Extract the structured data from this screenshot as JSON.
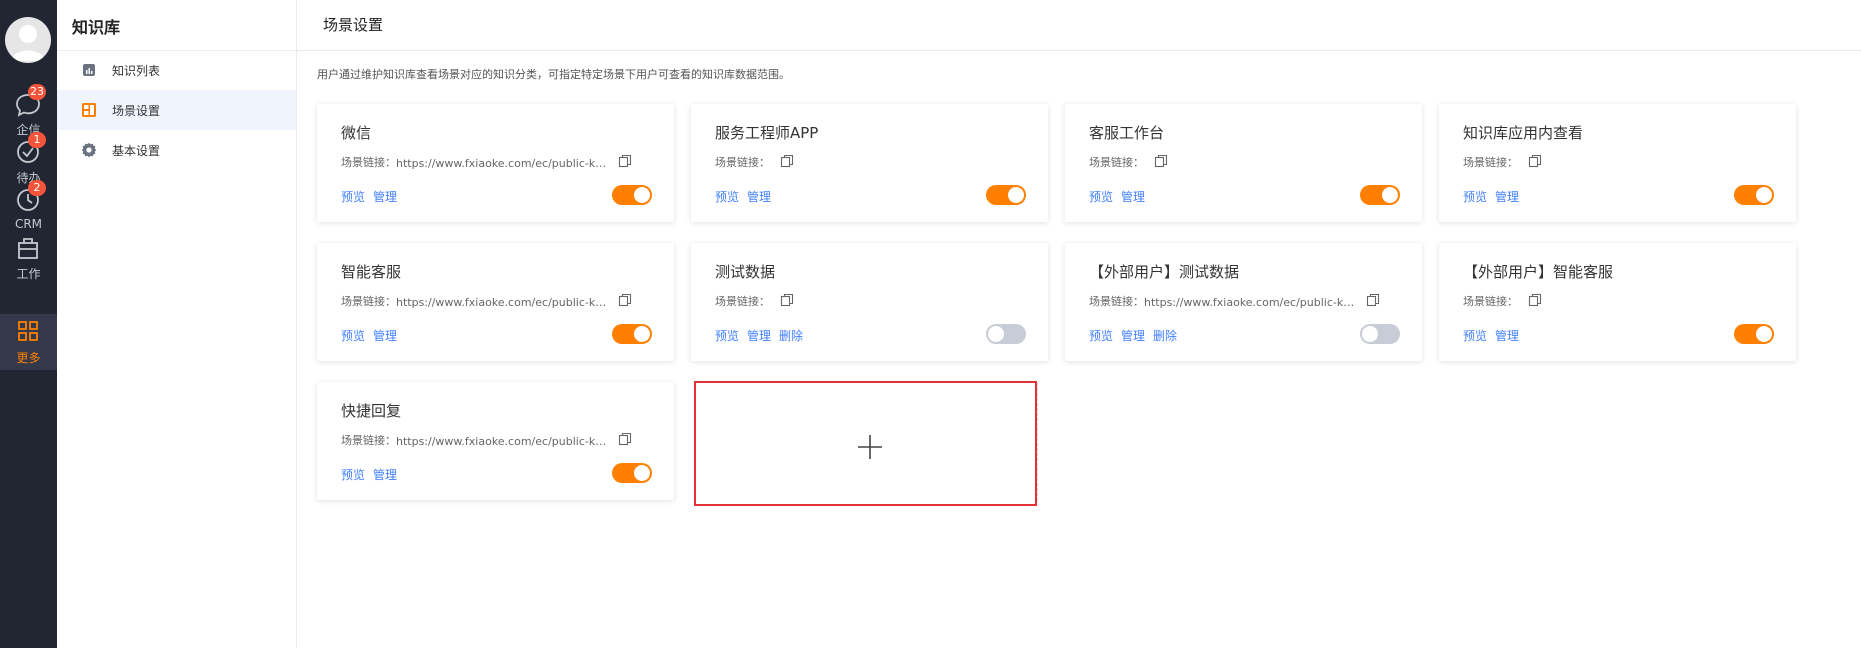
{
  "rail": {
    "items": [
      {
        "label": "企信",
        "badge": "23",
        "icon": "chat-bubble-icon"
      },
      {
        "label": "待办",
        "badge": "1",
        "icon": "check-circle-icon"
      },
      {
        "label": "CRM",
        "badge": "2",
        "icon": "clock-icon"
      },
      {
        "label": "工作",
        "badge": "",
        "icon": "briefcase-icon"
      },
      {
        "label": "更多",
        "badge": "",
        "icon": "grid-icon"
      }
    ]
  },
  "sidebar": {
    "title": "知识库",
    "items": [
      {
        "label": "知识列表",
        "icon": "bar-chart-icon"
      },
      {
        "label": "场景设置",
        "icon": "layout-icon"
      },
      {
        "label": "基本设置",
        "icon": "gear-icon"
      }
    ]
  },
  "main": {
    "title": "场景设置",
    "description": "用户通过维护知识库查看场景对应的知识分类，可指定特定场景下用户可查看的知识库数据范围。"
  },
  "cards": [
    {
      "title": "微信",
      "link_label": "场景链接：",
      "link_url": "https://www.fxiaoke.com/ec/public-knowledge",
      "actions": [
        "预览",
        "管理"
      ],
      "enabled": true
    },
    {
      "title": "服务工程师APP",
      "link_label": "场景链接：",
      "link_url": "",
      "actions": [
        "预览",
        "管理"
      ],
      "enabled": true
    },
    {
      "title": "客服工作台",
      "link_label": "场景链接：",
      "link_url": "",
      "actions": [
        "预览",
        "管理"
      ],
      "enabled": true
    },
    {
      "title": "知识库应用内查看",
      "link_label": "场景链接：",
      "link_url": "",
      "actions": [
        "预览",
        "管理"
      ],
      "enabled": true
    },
    {
      "title": "智能客服",
      "link_label": "场景链接：",
      "link_url": "https://www.fxiaoke.com/ec/public-knowledge",
      "actions": [
        "预览",
        "管理"
      ],
      "enabled": true
    },
    {
      "title": "测试数据",
      "link_label": "场景链接：",
      "link_url": "",
      "actions": [
        "预览",
        "管理",
        "删除"
      ],
      "enabled": false
    },
    {
      "title": "【外部用户】测试数据",
      "link_label": "场景链接：",
      "link_url": "https://www.fxiaoke.com/ec/public-knowledge",
      "actions": [
        "预览",
        "管理",
        "删除"
      ],
      "enabled": false
    },
    {
      "title": "【外部用户】智能客服",
      "link_label": "场景链接：",
      "link_url": "",
      "actions": [
        "预览",
        "管理"
      ],
      "enabled": true
    },
    {
      "title": "快捷回复",
      "link_label": "场景链接：",
      "link_url": "https://www.fxiaoke.com/ec/public-knowledge",
      "actions": [
        "预览",
        "管理"
      ],
      "enabled": true
    }
  ],
  "add_card": {
    "icon": "plus-icon"
  },
  "colors": {
    "accent": "#ff8000",
    "link": "#407fff",
    "rail_bg": "#222632",
    "badge": "#f4553a",
    "highlight_border": "#e5323a"
  }
}
